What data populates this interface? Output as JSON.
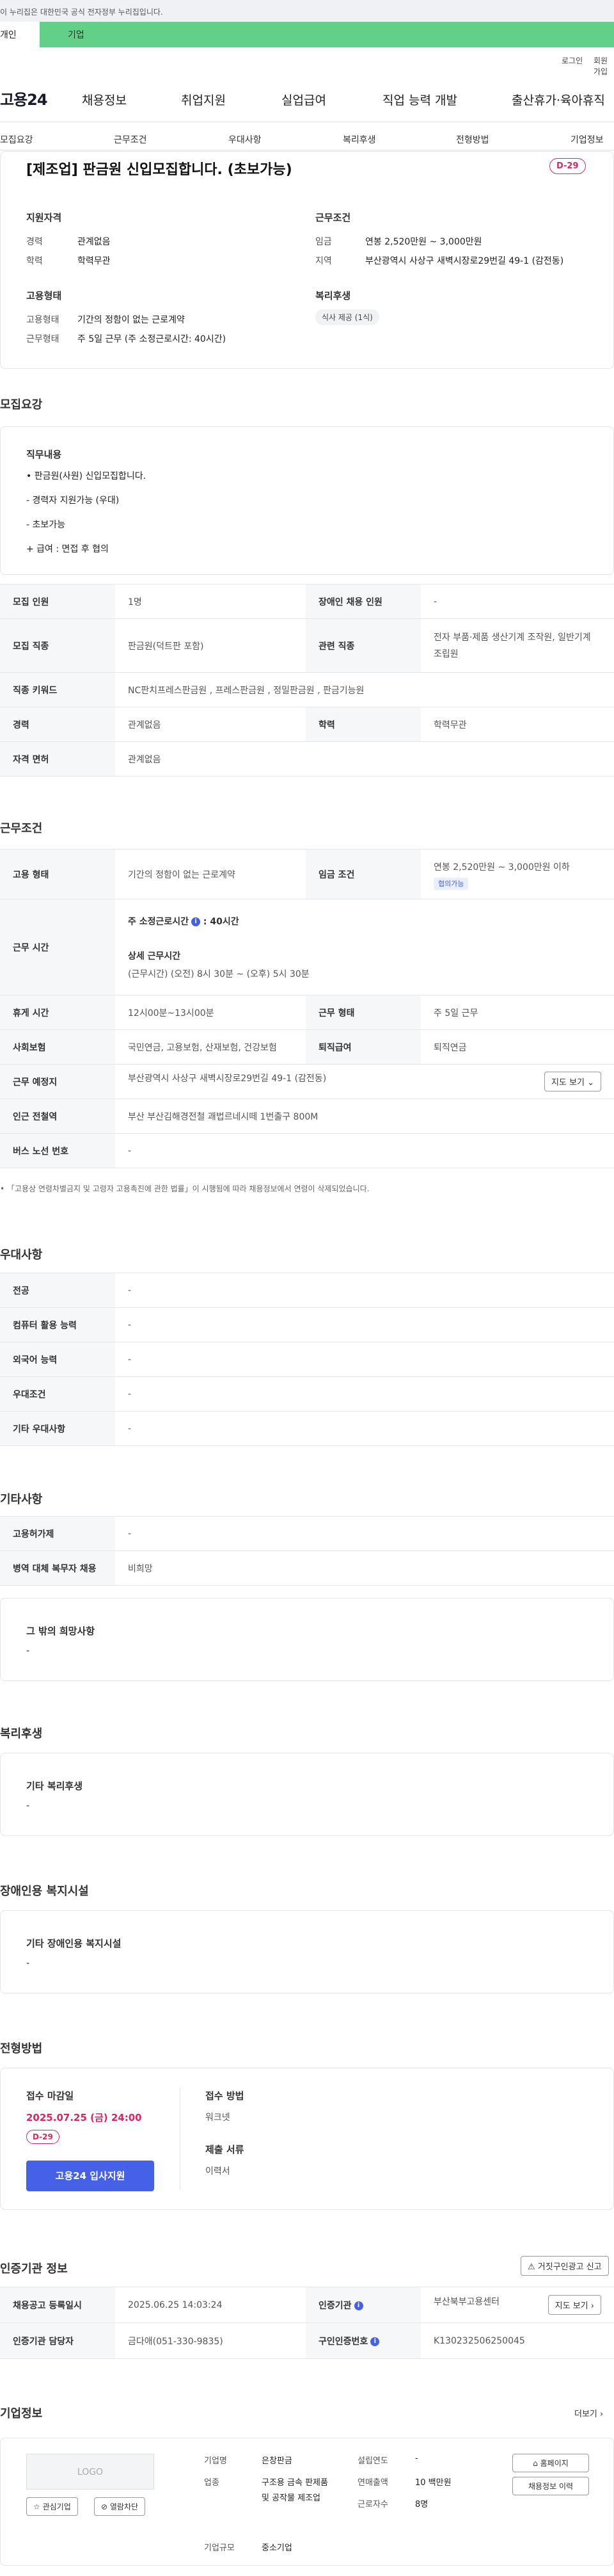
{
  "gov_banner": "이 누리집은 대한민국 공식 전자정부 누리집입니다.",
  "top_tabs": {
    "left": "개인",
    "right": "기업"
  },
  "util_links": {
    "login": "로그인",
    "join": "회원가입"
  },
  "site_logo": "고용24",
  "gnb": [
    "채용정보",
    "취업지원",
    "실업급여",
    "직업 능력 개발",
    "출산휴가·육아휴직"
  ],
  "subnav": [
    "모집요강",
    "근무조건",
    "우대사항",
    "복리후생",
    "전형방법",
    "기업정보"
  ],
  "job": {
    "title": "[제조업] 판금원 신입모집합니다. (초보가능)",
    "dday": "D-29",
    "qual_head": "지원자격",
    "career_label": "경력",
    "career_value": "관계없음",
    "edu_label": "학력",
    "edu_value": "학력무관",
    "cond_head": "근무조건",
    "wage_label": "임금",
    "wage_value": "연봉 2,520만원 ~ 3,000만원",
    "region_label": "지역",
    "region_value": "부산광역시 사상구 새벽시장로29번길 49-1 (감전동)",
    "emp_head": "고용형태",
    "emp_type_label": "고용형태",
    "emp_type_value": "기간의 정함이 없는 근로계약",
    "work_type_label": "근무형태",
    "work_type_value": "주 5일 근무 (주 소정근로시간: 40시간)",
    "welfare_head": "복리후생",
    "welfare_badge": "식사 제공 (1식)"
  },
  "recruit": {
    "section_title": "모집요강",
    "duty_head": "직무내용",
    "duty_lines": [
      "• 판금원(사원) 신입모집합니다.",
      "- 경력자 지원가능 (우대)",
      "- 초보가능",
      "+ 급여 : 면접 후 협의"
    ],
    "rows": [
      [
        "모집 인원",
        "1명",
        "장애인 채용 인원",
        "-"
      ],
      [
        "모집 직종",
        "판금원(덕트판 포함)",
        "관련 직종",
        "전자 부품·제품 생산기계 조작원, 일반기계 조립원"
      ],
      [
        "직종 키워드",
        "NC판치프레스판금원 , 프레스판금원 , 정밀판금원 , 판금기능원"
      ],
      [
        "경력",
        "관계없음",
        "학력",
        "학력무관"
      ],
      [
        "자격 면허",
        "관계없음"
      ]
    ]
  },
  "conditions": {
    "section_title": "근무조건",
    "emp_label": "고용 형태",
    "emp_value": "기간의 정함이 없는 근로계약",
    "wage_label": "임금 조건",
    "wage_value": "연봉 2,520만원 ~ 3,000만원 이하",
    "wage_tag": "협의가능",
    "hours_label": "근무 시간",
    "hours_week": "주 소정근로시간",
    "hours_week_value": ": 40시간",
    "hours_detail_head": "상세 근무시간",
    "hours_detail": "(근무시간) (오전) 8시 30분 ~ (오후) 5시 30분",
    "rows": [
      [
        "휴게 시간",
        "12시00분~13시00분",
        "근무 형태",
        "주 5일 근무"
      ],
      [
        "사회보험",
        "국민연금, 고용보험, 산재보험, 건강보험",
        "퇴직급여",
        "퇴직연금"
      ],
      [
        "근무 예정지",
        "부산광역시 사상구 새벽시장로29번길 49-1 (감전동)"
      ],
      [
        "인근 전철역",
        "부산 부산김해경전철 괘법르네시떼 1번출구 800M"
      ],
      [
        "버스 노선 번호",
        "-"
      ]
    ],
    "map_button": "지도 보기",
    "notice": "「고용상 연령차별금지 및 고령자 고용촉진에 관한 법률」이 시행됨에 따라 채용정보에서 연령이 삭제되었습니다."
  },
  "prefer": {
    "section_title": "우대사항",
    "rows": [
      [
        "전공",
        "-"
      ],
      [
        "컴퓨터 활용 능력",
        "-"
      ],
      [
        "외국어 능력",
        "-"
      ],
      [
        "우대조건",
        "-"
      ],
      [
        "기타 우대사항",
        "-"
      ]
    ]
  },
  "etc": {
    "section_title": "기타사항",
    "rows": [
      [
        "고용허가제",
        "-"
      ],
      [
        "병역 대체 복무자 채용",
        "비희망"
      ]
    ],
    "box_head": "그 밖의 희망사항",
    "box_value": "-"
  },
  "welfare": {
    "section_title": "복리후생",
    "box_head": "기타 복리후생",
    "box_value": "-"
  },
  "disability": {
    "section_title": "장애인용 복지시설",
    "box_head": "기타 장애인용 복지시설",
    "box_value": "-"
  },
  "process": {
    "section_title": "전형방법",
    "deadline_head": "접수 마감일",
    "deadline": "2025.07.25 (금) 24:00",
    "dday": "D-29",
    "apply_button": "고용24 입사지원",
    "method_head": "접수 방법",
    "method_value": "워크넷",
    "docs_head": "제출 서류",
    "docs_value": "이력서"
  },
  "auth": {
    "section_title": "인증기관 정보",
    "report_button": "거짓구인광고 신고",
    "reg_date_label": "채용공고 등록일시",
    "reg_date_value": "2025.06.25 14:03:24",
    "agency_label": "인증기관",
    "agency_value": "부산북부고용센터",
    "map_button": "지도 보기",
    "manager_label": "인증기관 담당자",
    "manager_value": "금다애(051-330-9835)",
    "notice_no_label": "구인인증번호",
    "notice_no_value": "K130232506250045"
  },
  "company": {
    "section_title": "기업정보",
    "more": "더보기",
    "logo": "LOGO",
    "fav_button": "관심기업",
    "block_button": "열람차단",
    "name_label": "기업명",
    "name_value": "은창판금",
    "industry_label": "업종",
    "industry_value": "구조용 금속 판제품 및 공작물 제조업",
    "size_label": "기업규모",
    "size_value": "중소기업",
    "founded_label": "설립연도",
    "founded_value": "-",
    "sales_label": "연매출액",
    "sales_value": "10 백만원",
    "staff_label": "근로자수",
    "staff_value": "8명",
    "home_button": "홈페이지",
    "jobs_button": "채용정보 이력"
  }
}
